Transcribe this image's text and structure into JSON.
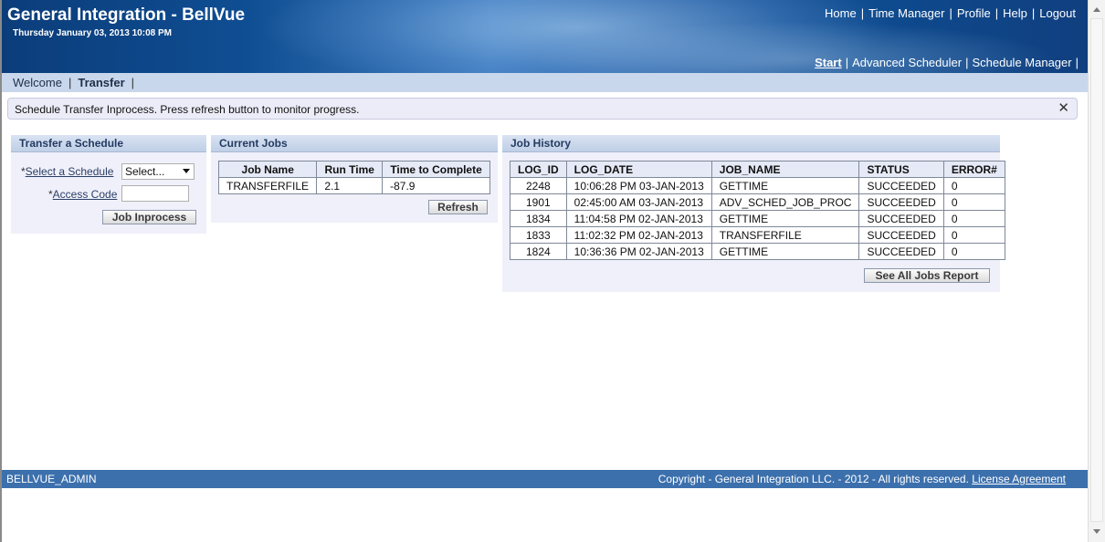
{
  "header": {
    "title": "General Integration - BellVue",
    "date": "Thursday January 03, 2013 10:08 PM",
    "top_links": [
      "Home",
      "Time Manager",
      "Profile",
      "Help",
      "Logout"
    ],
    "nav_links": [
      "Start",
      "Advanced Scheduler",
      "Schedule Manager"
    ],
    "active_nav": "Start"
  },
  "tabs": {
    "welcome": "Welcome",
    "transfer": "Transfer"
  },
  "message": {
    "text": "Schedule Transfer Inprocess. Press refresh button to monitor progress.",
    "close": "✕"
  },
  "transfer_panel": {
    "title": "Transfer a Schedule",
    "select_label": "Select a Schedule",
    "select_value": "Select...",
    "access_label": "Access Code",
    "access_value": "",
    "required_marker": "*",
    "button": "Job Inprocess"
  },
  "current_jobs": {
    "title": "Current Jobs",
    "columns": [
      "Job Name",
      "Run Time",
      "Time to Complete"
    ],
    "rows": [
      [
        "TRANSFERFILE",
        "2.1",
        "-87.9"
      ]
    ],
    "refresh": "Refresh"
  },
  "job_history": {
    "title": "Job History",
    "columns": [
      "LOG_ID",
      "LOG_DATE",
      "JOB_NAME",
      "STATUS",
      "ERROR#"
    ],
    "rows": [
      [
        "2248",
        "10:06:28 PM 03-JAN-2013",
        "GETTIME",
        "SUCCEEDED",
        "0"
      ],
      [
        "1901",
        "02:45:00 AM 03-JAN-2013",
        "ADV_SCHED_JOB_PROC",
        "SUCCEEDED",
        "0"
      ],
      [
        "1834",
        "11:04:58 PM 02-JAN-2013",
        "GETTIME",
        "SUCCEEDED",
        "0"
      ],
      [
        "1833",
        "11:02:32 PM 02-JAN-2013",
        "TRANSFERFILE",
        "SUCCEEDED",
        "0"
      ],
      [
        "1824",
        "10:36:36 PM 02-JAN-2013",
        "GETTIME",
        "SUCCEEDED",
        "0"
      ]
    ],
    "report_button": "See All Jobs Report"
  },
  "footer": {
    "user": "BELLVUE_ADMIN",
    "copyright": "Copyright - General Integration LLC. - 2012 - All rights reserved.",
    "license": "License Agreement"
  }
}
